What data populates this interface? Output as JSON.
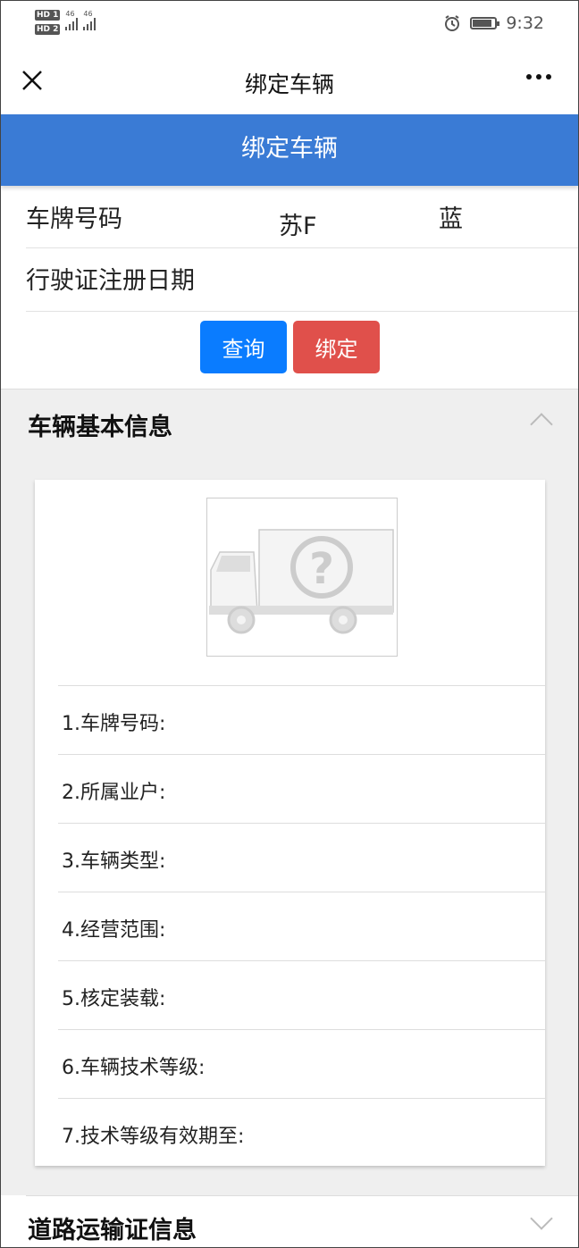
{
  "status_bar": {
    "hd1": "HD 1",
    "hd2": "HD 2",
    "net1": "46",
    "net2": "46",
    "time": "9:32"
  },
  "titlebar": {
    "title": "绑定车辆"
  },
  "banner": {
    "title": "绑定车辆"
  },
  "form": {
    "plate_label": "车牌号码",
    "plate_prefix": "苏F",
    "plate_color": "蓝",
    "reg_date_label": "行驶证注册日期"
  },
  "buttons": {
    "query": "查询",
    "bind": "绑定"
  },
  "vehicle_section": {
    "title": "车辆基本信息",
    "items": [
      "1.车牌号码:",
      "2.所属业户:",
      "3.车辆类型:",
      "4.经营范围:",
      "5.核定装载:",
      "6.车辆技术等级:",
      "7.技术等级有效期至:"
    ]
  },
  "transport_section": {
    "title": "道路运输证信息"
  },
  "colors": {
    "banner": "#3a7bd5",
    "query_button": "#0a7cff",
    "bind_button": "#e0504b"
  },
  "icons": [
    "close-icon",
    "more-icon",
    "chevron-up-icon",
    "chevron-down-icon",
    "truck-placeholder-icon",
    "alarm-icon",
    "battery-icon"
  ]
}
